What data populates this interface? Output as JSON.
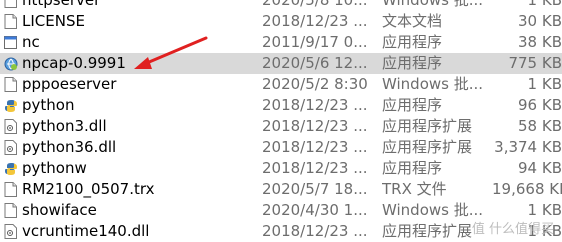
{
  "files": [
    {
      "icon": "doc-icon",
      "name": "httpserver",
      "date": "2020/5/8 10...",
      "type": "Windows 批...",
      "size": "1 KB"
    },
    {
      "icon": "doc-icon",
      "name": "LICENSE",
      "date": "2018/12/23 ...",
      "type": "文本文档",
      "size": "30 KB"
    },
    {
      "icon": "exe-icon",
      "name": "nc",
      "date": "2011/9/17 0...",
      "type": "应用程序",
      "size": "38 KB"
    },
    {
      "icon": "globe-app-icon",
      "name": "npcap-0.9991",
      "date": "2020/5/6 12...",
      "type": "应用程序",
      "size": "775 KB",
      "selected": true
    },
    {
      "icon": "doc-icon",
      "name": "pppoeserver",
      "date": "2020/5/2 8:30",
      "type": "Windows 批...",
      "size": "1 KB"
    },
    {
      "icon": "python-icon",
      "name": "python",
      "date": "2018/12/23 ...",
      "type": "应用程序",
      "size": "96 KB"
    },
    {
      "icon": "dll-icon",
      "name": "python3.dll",
      "date": "2018/12/23 ...",
      "type": "应用程序扩展",
      "size": "58 KB"
    },
    {
      "icon": "dll-icon",
      "name": "python36.dll",
      "date": "2018/12/23 ...",
      "type": "应用程序扩展",
      "size": "3,374 KB"
    },
    {
      "icon": "python-icon",
      "name": "pythonw",
      "date": "2018/12/23 ...",
      "type": "应用程序",
      "size": "94 KB"
    },
    {
      "icon": "doc-icon",
      "name": "RM2100_0507.trx",
      "date": "2020/5/7 18...",
      "type": "TRX 文件",
      "size": "19,668 KB"
    },
    {
      "icon": "doc-icon",
      "name": "showiface",
      "date": "2020/4/30 1...",
      "type": "Windows 批...",
      "size": "1 KB"
    },
    {
      "icon": "dll-icon",
      "name": "vcruntime140.dll",
      "date": "2018/12/23 ...",
      "type": "应用程序扩展",
      "size": "1 KB"
    }
  ],
  "annotation": {
    "color": "#e02020"
  },
  "watermark": "值 什么值得买"
}
